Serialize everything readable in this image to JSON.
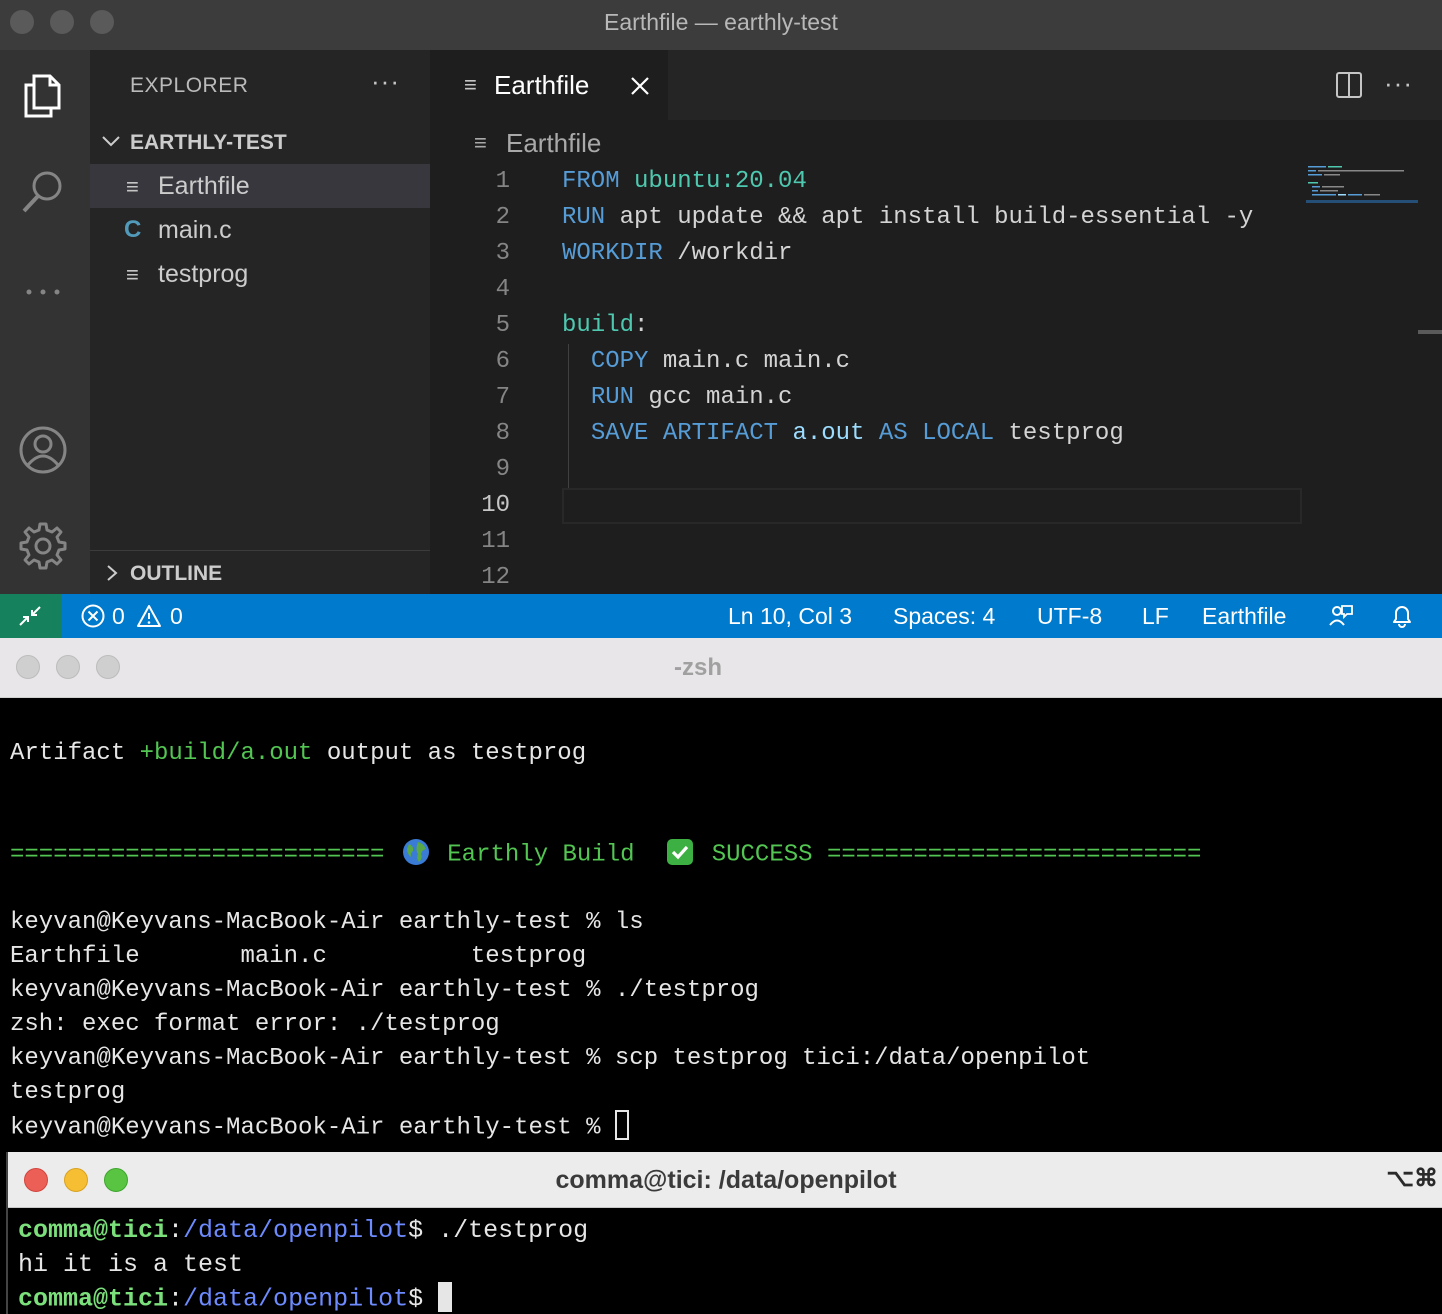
{
  "vscode": {
    "window_title": "Earthfile — earthly-test",
    "sidebar": {
      "title": "EXPLORER",
      "more": "···",
      "folder_name": "EARTHLY-TEST",
      "files": [
        {
          "name": "Earthfile",
          "icon": "≡",
          "active": true
        },
        {
          "name": "main.c",
          "icon": "C",
          "active": false
        },
        {
          "name": "testprog",
          "icon": "≡",
          "active": false
        }
      ],
      "outline_label": "OUTLINE"
    },
    "tab": {
      "icon": "≡",
      "label": "Earthfile"
    },
    "editor_more": "···",
    "breadcrumb": {
      "icon": "≡",
      "label": "Earthfile"
    },
    "line_numbers": [
      "1",
      "2",
      "3",
      "4",
      "5",
      "6",
      "7",
      "8",
      "9",
      "10",
      "11",
      "12"
    ],
    "current_line": "10",
    "code_lines": [
      [
        {
          "t": "FROM",
          "c": "kw"
        },
        {
          "t": " "
        },
        {
          "t": "ubuntu:20.04",
          "c": "ty"
        }
      ],
      [
        {
          "t": "RUN",
          "c": "kw"
        },
        {
          "t": " apt update && apt install build-essential -y"
        }
      ],
      [
        {
          "t": "WORKDIR",
          "c": "kw"
        },
        {
          "t": " /workdir"
        }
      ],
      [],
      [
        {
          "t": "build",
          "c": "ty"
        },
        {
          "t": ":"
        }
      ],
      [
        {
          "t": "  "
        },
        {
          "t": "COPY",
          "c": "kw"
        },
        {
          "t": " main.c main.c"
        }
      ],
      [
        {
          "t": "  "
        },
        {
          "t": "RUN",
          "c": "kw"
        },
        {
          "t": " gcc main.c"
        }
      ],
      [
        {
          "t": "  "
        },
        {
          "t": "SAVE ARTIFACT",
          "c": "kw"
        },
        {
          "t": " "
        },
        {
          "t": "a.out",
          "c": "lk"
        },
        {
          "t": " "
        },
        {
          "t": "AS LOCAL",
          "c": "kw"
        },
        {
          "t": " testprog"
        }
      ],
      [],
      [],
      [],
      []
    ],
    "statusbar": {
      "errors": "0",
      "warnings": "0",
      "position": "Ln 10, Col 3",
      "spaces": "Spaces: 4",
      "encoding": "UTF-8",
      "eol": "LF",
      "language": "Earthfile"
    },
    "colors": {
      "statusbar": "#007acc",
      "remote": "#16825d",
      "keyword": "#569cd6",
      "type": "#4ec9b0"
    }
  },
  "zsh": {
    "window_title": "-zsh",
    "artifact_line": {
      "prefix": "Artifact ",
      "target": "+build/a.out",
      "suffix": " output as testprog"
    },
    "success_line": {
      "left": "========================== ",
      "build": " Earthly Build  ",
      "success": " SUCCESS ",
      "right": "=========================="
    },
    "lines": [
      "keyvan@Keyvans-MacBook-Air earthly-test % ls",
      "Earthfile       main.c          testprog",
      "keyvan@Keyvans-MacBook-Air earthly-test % ./testprog",
      "zsh: exec format error: ./testprog",
      "keyvan@Keyvans-MacBook-Air earthly-test % scp testprog tici:/data/openpilot",
      "testprog"
    ],
    "last_prompt": "keyvan@Keyvans-MacBook-Air earthly-test % "
  },
  "comma": {
    "window_title": "comma@tici: /data/openpilot",
    "shortcut": "⌥⌘",
    "user": "comma@tici",
    "sep": ":",
    "path": "/data/openpilot",
    "dollar": "$",
    "command": " ./testprog",
    "output": "hi it is a test"
  }
}
